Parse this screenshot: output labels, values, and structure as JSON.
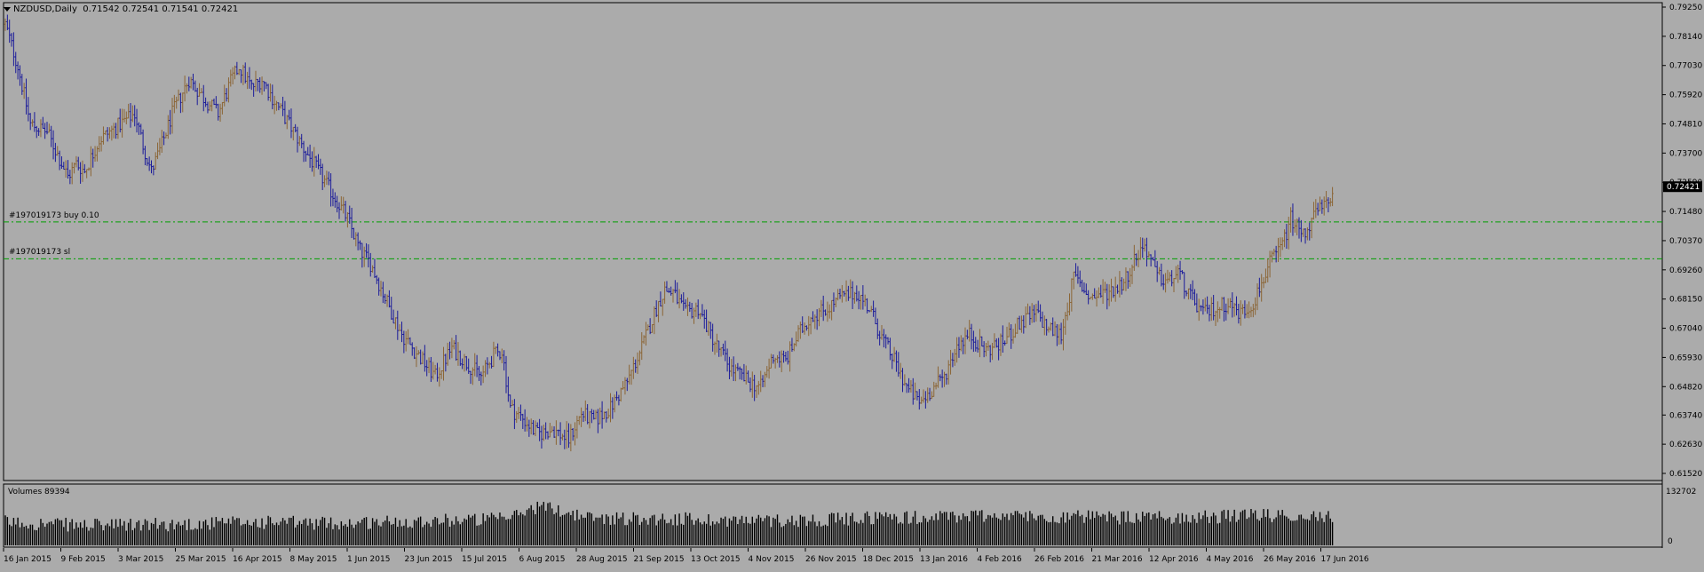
{
  "header": {
    "symbol_period": "NZDUSD,Daily",
    "ohlc": "0.71542 0.72541 0.71541 0.72421"
  },
  "volume_panel": {
    "label": "Volumes 89394",
    "max_label": "132702",
    "min_label": "0"
  },
  "orders": [
    {
      "label": "#197019173 buy 0.10",
      "price": 0.7108,
      "color": "#00a000"
    },
    {
      "label": "#197019173 sl",
      "price": 0.6968,
      "color": "#00a000"
    }
  ],
  "current_price": {
    "label": "0.72421",
    "value": 0.72421
  },
  "colors": {
    "background": "#ababab",
    "bull_bar": "#8b6535",
    "bear_bar": "#1b1b9a",
    "volume_bar": "#000000",
    "grid_line": "#000000"
  },
  "chart_data": {
    "type": "ohlc",
    "price_axis": {
      "ticks": [
        "0.79250",
        "0.78140",
        "0.77030",
        "0.75920",
        "0.74810",
        "0.73700",
        "0.72590",
        "0.71480",
        "0.70370",
        "0.69260",
        "0.68150",
        "0.67040",
        "0.65930",
        "0.64820",
        "0.63740",
        "0.62630",
        "0.61520"
      ],
      "ylim": [
        0.6152,
        0.7925
      ]
    },
    "time_axis": {
      "ticks": [
        "16 Jan 2015",
        "9 Feb 2015",
        "3 Mar 2015",
        "25 Mar 2015",
        "16 Apr 2015",
        "8 May 2015",
        "1 Jun 2015",
        "23 Jun 2015",
        "15 Jul 2015",
        "6 Aug 2015",
        "28 Aug 2015",
        "21 Sep 2015",
        "13 Oct 2015",
        "4 Nov 2015",
        "26 Nov 2015",
        "18 Dec 2015",
        "13 Jan 2016",
        "4 Feb 2016",
        "26 Feb 2016",
        "21 Mar 2016",
        "12 Apr 2016",
        "4 May 2016",
        "26 May 2016",
        "17 Jun 2016"
      ]
    },
    "close_path": [
      [
        0,
        0.786
      ],
      [
        6,
        0.77
      ],
      [
        12,
        0.748
      ],
      [
        20,
        0.745
      ],
      [
        30,
        0.728
      ],
      [
        34,
        0.733
      ],
      [
        38,
        0.73
      ],
      [
        45,
        0.742
      ],
      [
        55,
        0.748
      ],
      [
        62,
        0.752
      ],
      [
        66,
        0.74
      ],
      [
        70,
        0.73
      ],
      [
        74,
        0.738
      ],
      [
        80,
        0.752
      ],
      [
        88,
        0.765
      ],
      [
        95,
        0.758
      ],
      [
        102,
        0.752
      ],
      [
        108,
        0.764
      ],
      [
        112,
        0.77
      ],
      [
        118,
        0.762
      ],
      [
        123,
        0.765
      ],
      [
        128,
        0.758
      ],
      [
        136,
        0.748
      ],
      [
        142,
        0.74
      ],
      [
        150,
        0.73
      ],
      [
        158,
        0.72
      ],
      [
        164,
        0.712
      ],
      [
        170,
        0.7
      ],
      [
        175,
        0.695
      ],
      [
        182,
        0.682
      ],
      [
        190,
        0.668
      ],
      [
        198,
        0.66
      ],
      [
        206,
        0.652
      ],
      [
        214,
        0.663
      ],
      [
        220,
        0.658
      ],
      [
        228,
        0.652
      ],
      [
        234,
        0.66
      ],
      [
        238,
        0.662
      ],
      [
        242,
        0.64
      ],
      [
        248,
        0.636
      ],
      [
        255,
        0.63
      ],
      [
        262,
        0.632
      ],
      [
        270,
        0.628
      ],
      [
        276,
        0.638
      ],
      [
        282,
        0.635
      ],
      [
        290,
        0.64
      ],
      [
        298,
        0.65
      ],
      [
        305,
        0.663
      ],
      [
        312,
        0.678
      ],
      [
        316,
        0.685
      ],
      [
        320,
        0.684
      ],
      [
        326,
        0.676
      ],
      [
        332,
        0.678
      ],
      [
        340,
        0.665
      ],
      [
        348,
        0.655
      ],
      [
        356,
        0.65
      ],
      [
        362,
        0.648
      ],
      [
        368,
        0.66
      ],
      [
        374,
        0.658
      ],
      [
        380,
        0.668
      ],
      [
        386,
        0.675
      ],
      [
        394,
        0.678
      ],
      [
        400,
        0.682
      ],
      [
        408,
        0.684
      ],
      [
        414,
        0.678
      ],
      [
        420,
        0.667
      ],
      [
        426,
        0.658
      ],
      [
        432,
        0.648
      ],
      [
        438,
        0.642
      ],
      [
        444,
        0.647
      ],
      [
        450,
        0.652
      ],
      [
        456,
        0.664
      ],
      [
        462,
        0.668
      ],
      [
        470,
        0.662
      ],
      [
        478,
        0.665
      ],
      [
        486,
        0.672
      ],
      [
        494,
        0.676
      ],
      [
        500,
        0.67
      ],
      [
        506,
        0.668
      ],
      [
        512,
        0.69
      ],
      [
        520,
        0.682
      ],
      [
        528,
        0.684
      ],
      [
        536,
        0.688
      ],
      [
        542,
        0.698
      ],
      [
        546,
        0.702
      ],
      [
        552,
        0.69
      ],
      [
        558,
        0.688
      ],
      [
        562,
        0.692
      ],
      [
        568,
        0.682
      ],
      [
        574,
        0.676
      ],
      [
        580,
        0.678
      ],
      [
        586,
        0.68
      ],
      [
        592,
        0.676
      ],
      [
        598,
        0.68
      ],
      [
        606,
        0.695
      ],
      [
        612,
        0.702
      ],
      [
        616,
        0.712
      ],
      [
        622,
        0.706
      ],
      [
        628,
        0.714
      ],
      [
        634,
        0.718
      ],
      [
        636,
        0.724
      ]
    ],
    "volume_path": [
      [
        0,
        0.42
      ],
      [
        40,
        0.36
      ],
      [
        80,
        0.38
      ],
      [
        120,
        0.42
      ],
      [
        160,
        0.4
      ],
      [
        200,
        0.45
      ],
      [
        240,
        0.48
      ],
      [
        256,
        0.72
      ],
      [
        280,
        0.5
      ],
      [
        320,
        0.48
      ],
      [
        360,
        0.45
      ],
      [
        400,
        0.47
      ],
      [
        420,
        0.52
      ],
      [
        440,
        0.5
      ],
      [
        470,
        0.55
      ],
      [
        500,
        0.52
      ],
      [
        540,
        0.5
      ],
      [
        580,
        0.52
      ],
      [
        610,
        0.55
      ],
      [
        636,
        0.52
      ]
    ]
  }
}
